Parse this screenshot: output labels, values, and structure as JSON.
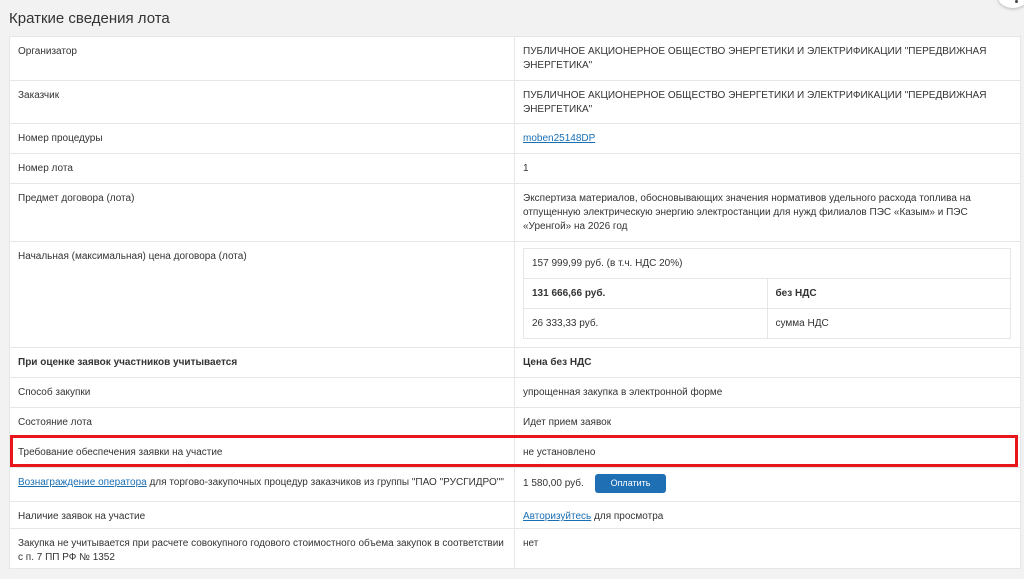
{
  "section": {
    "title": "Краткие сведения лота"
  },
  "rows": {
    "organizer": {
      "label": "Организатор",
      "value": "ПУБЛИЧНОЕ АКЦИОНЕРНОЕ ОБЩЕСТВО ЭНЕРГЕТИКИ И ЭЛЕКТРИФИКАЦИИ \"ПЕРЕДВИЖНАЯ ЭНЕРГЕТИКА\""
    },
    "customer": {
      "label": "Заказчик",
      "value": "ПУБЛИЧНОЕ АКЦИОНЕРНОЕ ОБЩЕСТВО ЭНЕРГЕТИКИ И ЭЛЕКТРИФИКАЦИИ \"ПЕРЕДВИЖНАЯ ЭНЕРГЕТИКА\""
    },
    "procedure_number": {
      "label": "Номер процедуры",
      "value": "moben25148DP"
    },
    "lot_number": {
      "label": "Номер лота",
      "value": "1"
    },
    "subject": {
      "label": "Предмет договора (лота)",
      "value": "Экспертиза материалов, обосновывающих значения нормативов удельного расхода топлива на отпущенную электрическую энергию электростанции для нужд филиалов ПЭС «Казым» и ПЭС «Уренгой» на 2026 год"
    },
    "initial_price": {
      "label": "Начальная (максимальная) цена договора (лота)",
      "total_with_vat": "157 999,99 руб. (в т.ч. НДС 20%)",
      "amount_no_vat": "131 666,66 руб.",
      "amount_no_vat_note": "без НДС",
      "vat_amount": "26 333,33 руб.",
      "vat_amount_note": "сумма НДС"
    },
    "evaluation": {
      "label": "При оценке заявок участников учитывается",
      "value": "Цена без НДС"
    },
    "method": {
      "label": "Способ закупки",
      "value": "упрощенная закупка в электронной форме"
    },
    "state": {
      "label": "Состояние лота",
      "value": "Идет прием заявок"
    },
    "security": {
      "label": "Требование обеспечения заявки на участие",
      "value": "не установлено"
    },
    "operator_fee": {
      "link": "Вознаграждение оператора",
      "label_rest": " для торгово-закупочных процедур заказчиков из группы \"ПАО \"РУСГИДРО\"\"",
      "value": "1 580,00 руб.",
      "button": "Оплатить"
    },
    "applications": {
      "label": "Наличие заявок на участие",
      "link": "Авторизуйтесь",
      "value_rest": " для просмотра"
    },
    "annual_volume": {
      "label": "Закупка не учитывается при расчете совокупного годового стоимостного объема закупок в соответствии с п. 7 ПП РФ № 1352",
      "value": "нет"
    }
  },
  "colors": {
    "link": "#1a6fb3",
    "button": "#1f6fb5",
    "highlight": "#e8151b"
  }
}
